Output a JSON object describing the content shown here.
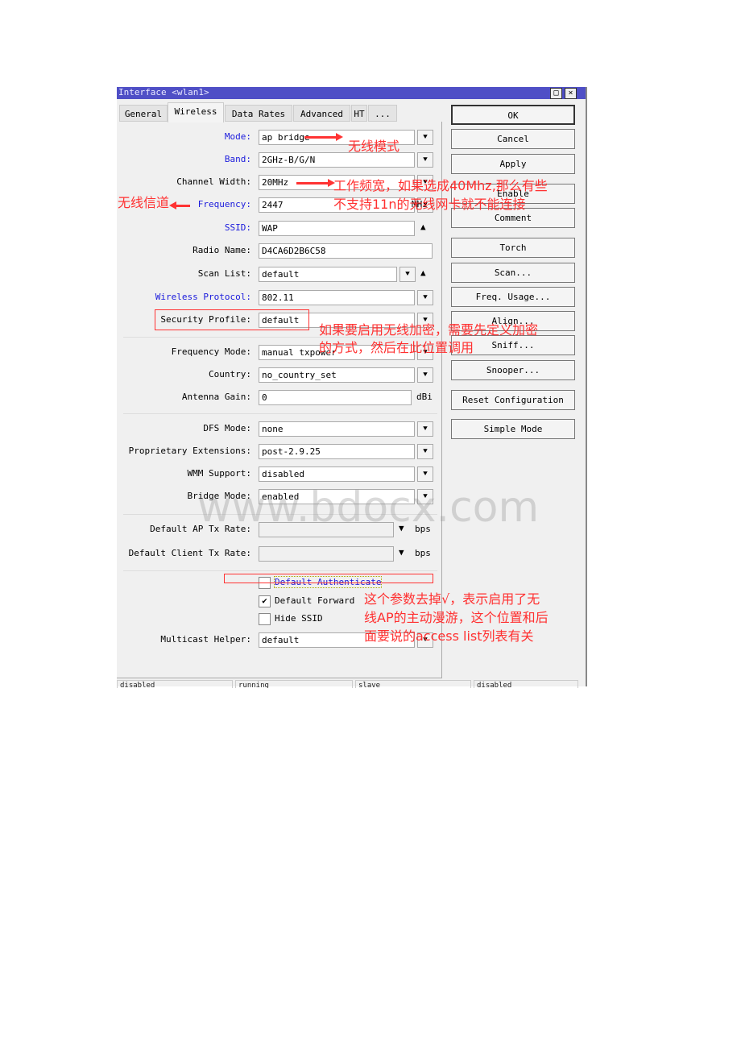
{
  "window": {
    "title": "Interface <wlan1>",
    "minimize": "□",
    "close": "×"
  },
  "tabs": [
    {
      "label": "General"
    },
    {
      "label": "Wireless",
      "active": true
    },
    {
      "label": "Data Rates"
    },
    {
      "label": "Advanced"
    },
    {
      "label": "HT"
    },
    {
      "label": "..."
    }
  ],
  "fields": [
    {
      "label": "Mode:",
      "value": "ap bridge",
      "blue": true,
      "control": "dropdown"
    },
    {
      "label": "Band:",
      "value": "2GHz-B/G/N",
      "blue": true,
      "control": "dropdown"
    },
    {
      "label": "Channel Width:",
      "value": "20MHz",
      "control": "dropdown"
    },
    {
      "label": "Frequency:",
      "value": "2447",
      "blue": true,
      "control": "dropdown",
      "unit": "MHz"
    },
    {
      "label": "SSID:",
      "value": "WAP",
      "blue": true,
      "control": "collapse"
    },
    {
      "label": "Radio Name:",
      "value": "D4CA6D2B6C58",
      "control": "none"
    },
    {
      "label": "Scan List:",
      "value": "default",
      "control": "dropdown-collapse"
    },
    {
      "label": "Wireless Protocol:",
      "value": "802.11",
      "blue": true,
      "control": "dropdown"
    },
    {
      "label": "Security Profile:",
      "value": "default",
      "control": "dropdown"
    },
    {
      "label": "Frequency Mode:",
      "value": "manual txpower",
      "control": "dropdown"
    },
    {
      "label": "Country:",
      "value": "no_country_set",
      "control": "dropdown"
    },
    {
      "label": "Antenna Gain:",
      "value": "0",
      "control": "none",
      "unit": "dBi"
    },
    {
      "label": "DFS Mode:",
      "value": "none",
      "control": "dropdown"
    },
    {
      "label": "Proprietary Extensions:",
      "value": "post-2.9.25",
      "control": "dropdown"
    },
    {
      "label": "WMM Support:",
      "value": "disabled",
      "control": "dropdown"
    },
    {
      "label": "Bridge Mode:",
      "value": "enabled",
      "control": "dropdown"
    },
    {
      "label": "Default AP Tx Rate:",
      "value": "",
      "control": "disabled",
      "unit": "bps"
    },
    {
      "label": "Default Client Tx Rate:",
      "value": "",
      "control": "disabled",
      "unit": "bps"
    },
    {
      "label": "Multicast Helper:",
      "value": "default",
      "control": "dropdown"
    }
  ],
  "checkboxes": [
    {
      "label": "Default Authenticate",
      "checked": false
    },
    {
      "label": "Default Forward",
      "checked": true
    },
    {
      "label": "Hide SSID",
      "checked": false
    }
  ],
  "buttons": [
    "OK",
    "Cancel",
    "Apply",
    "Enable",
    "Comment",
    "Torch",
    "Scan...",
    "Freq. Usage...",
    "Align...",
    "Sniff...",
    "Snooper...",
    "Reset Configuration",
    "Simple Mode"
  ],
  "status": [
    "disabled",
    "running",
    "slave",
    "disabled"
  ],
  "annotations": {
    "mode": "无线模式",
    "channel_width": [
      "工作频宽，如果选成40Mhz,那么有些",
      "不支持11n的无线网卡就不能连接"
    ],
    "frequency": "无线信道",
    "security": [
      "如果要启用无线加密，需要先定义加密",
      "的方式，然后在此位置调用"
    ],
    "authenticate": [
      "这个参数去掉√，表示启用了无",
      "线AP的主动漫游，这个位置和后",
      "面要说的access list列表有关"
    ]
  },
  "watermark": "www.bdocx.com",
  "colors": {
    "titlebar": "#4f4fc6",
    "annotation": "#ff3030",
    "blue_label": "#1a1adc"
  }
}
